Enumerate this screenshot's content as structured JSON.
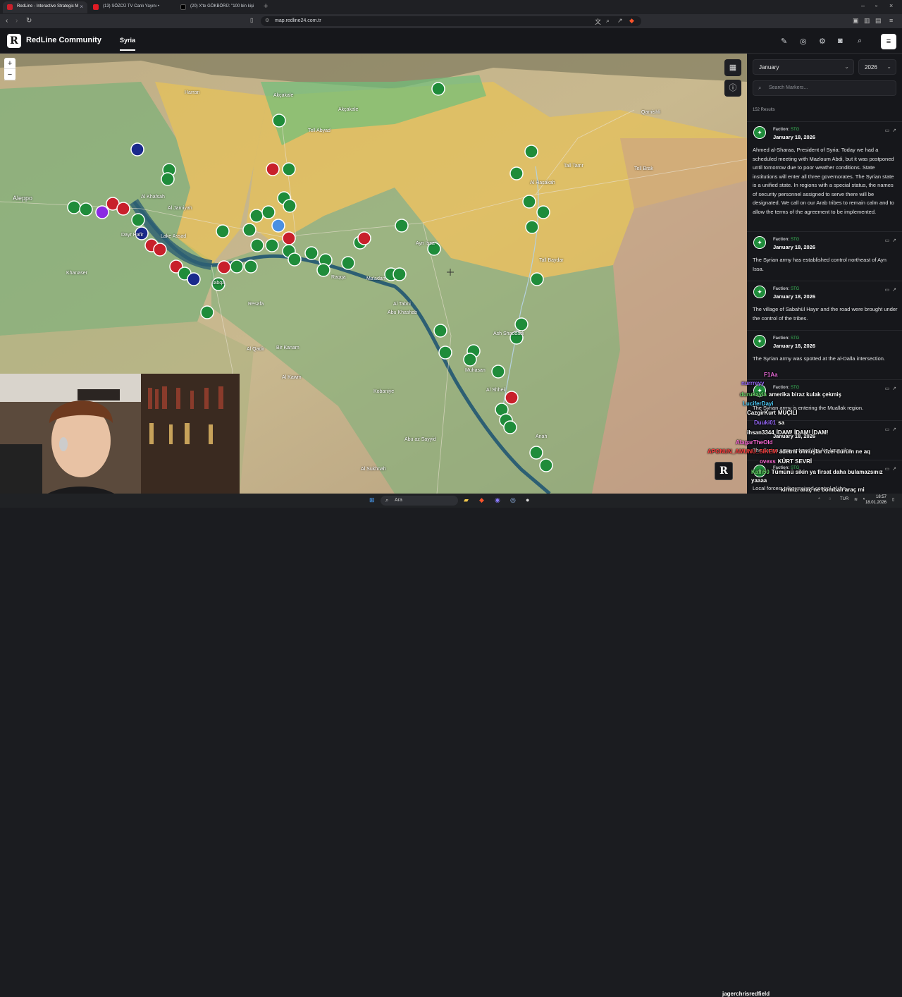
{
  "browser": {
    "tabs": [
      {
        "title": "RedLine - Interactive Strategic M",
        "active": true
      },
      {
        "title": "(13) SÖZCÜ TV Canlı Yayını •",
        "active": false
      },
      {
        "title": "(20) X'te GÖKBÖRÜ: \"100 bin kişi",
        "active": false
      }
    ],
    "url": "map.redline24.com.tr"
  },
  "header": {
    "brand": "RedLine Community",
    "logo_letter": "R",
    "region_tab": "Syria",
    "icons": [
      "edit-location-icon",
      "pin-icon",
      "settings-icon",
      "camera-icon",
      "search-icon",
      "menu-icon"
    ]
  },
  "map": {
    "labels": [
      {
        "text": "Aleppo",
        "big": true
      },
      {
        "text": "Harran"
      },
      {
        "text": "Akçakale"
      },
      {
        "text": "Akçakale"
      },
      {
        "text": "Tell Abyad"
      },
      {
        "text": "Al Khafsah"
      },
      {
        "text": "Dayr Hafir"
      },
      {
        "text": "Al Jarniyah"
      },
      {
        "text": "Lake Assad"
      },
      {
        "text": "Tabqa"
      },
      {
        "text": "Raqqa"
      },
      {
        "text": "Ma'adan"
      },
      {
        "text": "Al Tabni"
      },
      {
        "text": "Resafa"
      },
      {
        "text": "Al Qadir"
      },
      {
        "text": "Bir Kanam"
      },
      {
        "text": "Abu Khashab"
      },
      {
        "text": "Kobaniye"
      },
      {
        "text": "Al Kawm"
      },
      {
        "text": "Muhasan"
      },
      {
        "text": "Al Shheil"
      },
      {
        "text": "Abu az Sayyid"
      },
      {
        "text": "Ash Shaddadi"
      },
      {
        "text": "Tall Baydar"
      },
      {
        "text": "Al Hasakah"
      },
      {
        "text": "Tall Tamr"
      },
      {
        "text": "Ayn Issa"
      },
      {
        "text": "Khanaser"
      },
      {
        "text": "Qamishli"
      },
      {
        "text": "Tell Brak"
      },
      {
        "text": "Al Sukhnah"
      },
      {
        "text": "Anah"
      }
    ]
  },
  "sidebar": {
    "month": "January",
    "year": "2026",
    "search_placeholder": "Search Markers...",
    "results": "152 Results",
    "faction_label": "Faction:",
    "entries": [
      {
        "faction": "STG",
        "date": "January 18, 2026",
        "text": "Ahmed al-Sharaa, President of Syria: Today we had a scheduled meeting with Mazloum Abdi, but it was postponed until tomorrow due to poor weather conditions. State institutions will enter all three governorates. The Syrian state is a unified state. In regions with a special status, the names of security personnel assigned to serve there will be designated. We call on our Arab tribes to remain calm and to allow the terms of the agreement to be implemented."
      },
      {
        "faction": "STG",
        "date": "January 18, 2026",
        "text": "The Syrian army has established control northeast of Ayn Issa."
      },
      {
        "faction": "STG",
        "date": "January 18, 2026",
        "text": "The village of Sabahül Hayır and the road were brought under the control of the tribes."
      },
      {
        "faction": "STG",
        "date": "January 18, 2026",
        "text": "The Syrian army was spotted at the al-Dalla intersection."
      },
      {
        "faction": "STG",
        "date": "January 18, 2026",
        "text": "The Syrian army is entering the Muallak region."
      },
      {
        "faction": "STG",
        "date": "January 18, 2026",
        "text": "The Syrian army entered the Ain Issa silos."
      },
      {
        "faction": "STG",
        "date": "January 18, 2026",
        "text": "Local forces, tribes seized control of the ..."
      }
    ]
  },
  "chat": [
    {
      "name": "F1Aa",
      "msg": "",
      "color": "#e86bd8"
    },
    {
      "name": "nurrreyy",
      "msg": "",
      "color": "#9b6bff"
    },
    {
      "name": "durukayla",
      "msg": "amerika biraz kulak çekmiş",
      "color": "#6bd86b"
    },
    {
      "name": "LuciferDayi",
      "msg": "",
      "color": "#4fd1ff"
    },
    {
      "name": "CazgirKurt",
      "msg": "MUÇİLİ",
      "color": "#ffffff"
    },
    {
      "name": "Duuki01",
      "msg": "sa",
      "color": "#9b6bff"
    },
    {
      "name": "ihsan3344",
      "msg": "İDAM! İDAM! İDAM!",
      "color": "#ffffff"
    },
    {
      "name": "AlagarTheOld",
      "msg": "",
      "color": "#ff6bd8"
    },
    {
      "name": "APONUN_AMUNU_SIKEM",
      "msg": "adetmi olmuşlar özel durum ne aq",
      "color": "#ff4040"
    },
    {
      "name": "ovexs",
      "msg": "KÜRT SEVRİ",
      "color": "#ff6bd8"
    },
    {
      "name": "Kalli50",
      "msg": "Tümünü sikin ya firsat daha bulamazsınız yaaaa",
      "color": "#6bd86b"
    },
    {
      "name": "",
      "msg": "kirmizi araç ne bombalı araç mi",
      "color": "#ffffff"
    }
  ],
  "taskbar": {
    "search": "Ara",
    "lang": "TUR",
    "time": "18:57",
    "date": "18.01.2026",
    "streamer": "jagerchrisredfield"
  },
  "colors": {
    "stg_green": "#1f8c3a",
    "sdf_yellow": "#e6c25a",
    "red_marker": "#c8202b",
    "blue_marker": "#1a2a8c"
  }
}
